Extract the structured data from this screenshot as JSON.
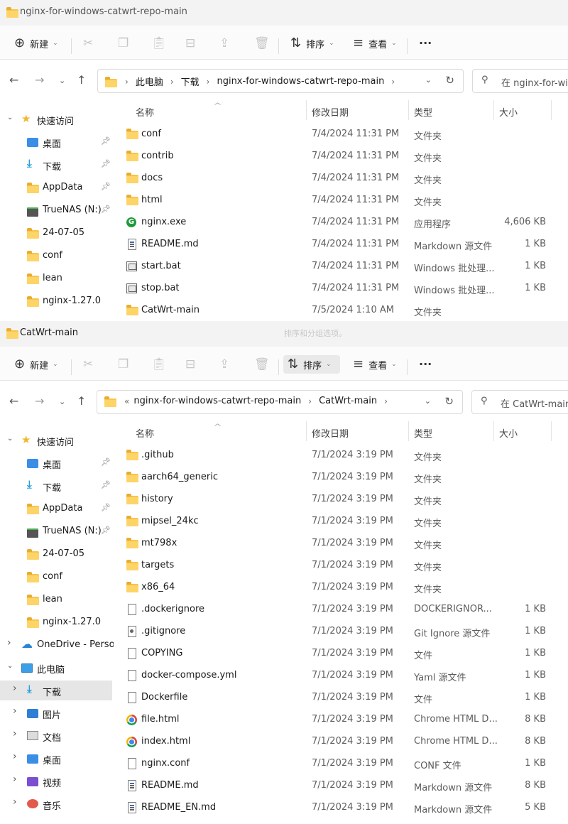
{
  "window1": {
    "title": "nginx-for-windows-catwrt-repo-main",
    "toolbar": {
      "new": "新建",
      "sort": "排序",
      "view": "查看",
      "more": "···"
    },
    "path": [
      "此电脑",
      "下载",
      "nginx-for-windows-catwrt-repo-main"
    ],
    "search_placeholder": "在 nginx-for-windo",
    "columns": {
      "name": "名称",
      "modified": "修改日期",
      "type": "类型",
      "size": "大小"
    },
    "sidebar": [
      {
        "label": "快速访问",
        "icon": "star-icon",
        "pinned": false
      },
      {
        "label": "桌面",
        "icon": "desktop-icon",
        "pinned": true
      },
      {
        "label": "下载",
        "icon": "download-icon",
        "pinned": true
      },
      {
        "label": "AppData",
        "icon": "folder-icon",
        "pinned": true
      },
      {
        "label": "TrueNAS (N:)",
        "icon": "network-drive-icon",
        "pinned": true
      },
      {
        "label": "24-07-05",
        "icon": "folder-icon",
        "pinned": false
      },
      {
        "label": "conf",
        "icon": "folder-icon",
        "pinned": false
      },
      {
        "label": "lean",
        "icon": "folder-icon",
        "pinned": false
      },
      {
        "label": "nginx-1.27.0",
        "icon": "folder-icon",
        "pinned": false
      }
    ],
    "files": [
      {
        "name": "conf",
        "date": "7/4/2024 11:31 PM",
        "type": "文件夹",
        "size": "",
        "icon": "folder"
      },
      {
        "name": "contrib",
        "date": "7/4/2024 11:31 PM",
        "type": "文件夹",
        "size": "",
        "icon": "folder"
      },
      {
        "name": "docs",
        "date": "7/4/2024 11:31 PM",
        "type": "文件夹",
        "size": "",
        "icon": "folder"
      },
      {
        "name": "html",
        "date": "7/4/2024 11:31 PM",
        "type": "文件夹",
        "size": "",
        "icon": "folder"
      },
      {
        "name": "nginx.exe",
        "date": "7/4/2024 11:31 PM",
        "type": "应用程序",
        "size": "4,606 KB",
        "icon": "exe"
      },
      {
        "name": "README.md",
        "date": "7/4/2024 11:31 PM",
        "type": "Markdown 源文件",
        "size": "1 KB",
        "icon": "md"
      },
      {
        "name": "start.bat",
        "date": "7/4/2024 11:31 PM",
        "type": "Windows 批处理...",
        "size": "1 KB",
        "icon": "bat"
      },
      {
        "name": "stop.bat",
        "date": "7/4/2024 11:31 PM",
        "type": "Windows 批处理...",
        "size": "1 KB",
        "icon": "bat"
      },
      {
        "name": "CatWrt-main",
        "date": "7/5/2024 1:10 AM",
        "type": "文件夹",
        "size": "",
        "icon": "folder"
      }
    ]
  },
  "window2": {
    "title": "CatWrt-main",
    "tooltip": "排序和分组选项。",
    "toolbar": {
      "new": "新建",
      "sort": "排序",
      "view": "查看",
      "more": "···"
    },
    "path_overflow": "«",
    "path": [
      "nginx-for-windows-catwrt-repo-main",
      "CatWrt-main"
    ],
    "search_placeholder": "在 CatWrt-main 中",
    "columns": {
      "name": "名称",
      "modified": "修改日期",
      "type": "类型",
      "size": "大小"
    },
    "sidebar": [
      {
        "label": "快速访问",
        "icon": "star-icon",
        "pinned": false,
        "expand": "v"
      },
      {
        "label": "桌面",
        "icon": "desktop-icon",
        "pinned": true
      },
      {
        "label": "下载",
        "icon": "download-icon",
        "pinned": true
      },
      {
        "label": "AppData",
        "icon": "folder-icon",
        "pinned": true
      },
      {
        "label": "TrueNAS (N:)",
        "icon": "network-drive-icon",
        "pinned": true
      },
      {
        "label": "24-07-05",
        "icon": "folder-icon",
        "pinned": false
      },
      {
        "label": "conf",
        "icon": "folder-icon",
        "pinned": false
      },
      {
        "label": "lean",
        "icon": "folder-icon",
        "pinned": false
      },
      {
        "label": "nginx-1.27.0",
        "icon": "folder-icon",
        "pinned": false
      },
      {
        "label": "OneDrive - Persor",
        "icon": "cloud-icon",
        "pinned": false,
        "expand": ">"
      },
      {
        "label": "此电脑",
        "icon": "pc-icon",
        "pinned": false,
        "expand": "v"
      },
      {
        "label": "下载",
        "icon": "download-icon",
        "pinned": false,
        "expand": ">",
        "selected": true
      },
      {
        "label": "图片",
        "icon": "pictures-icon",
        "pinned": false,
        "expand": ">"
      },
      {
        "label": "文档",
        "icon": "documents-icon",
        "pinned": false,
        "expand": ">"
      },
      {
        "label": "桌面",
        "icon": "desktop-icon",
        "pinned": false,
        "expand": ">"
      },
      {
        "label": "视频",
        "icon": "videos-icon",
        "pinned": false,
        "expand": ">"
      },
      {
        "label": "音乐",
        "icon": "music-icon",
        "pinned": false,
        "expand": ">"
      }
    ],
    "files": [
      {
        "name": ".github",
        "date": "7/1/2024 3:19 PM",
        "type": "文件夹",
        "size": "",
        "icon": "folder"
      },
      {
        "name": "aarch64_generic",
        "date": "7/1/2024 3:19 PM",
        "type": "文件夹",
        "size": "",
        "icon": "folder"
      },
      {
        "name": "history",
        "date": "7/1/2024 3:19 PM",
        "type": "文件夹",
        "size": "",
        "icon": "folder"
      },
      {
        "name": "mipsel_24kc",
        "date": "7/1/2024 3:19 PM",
        "type": "文件夹",
        "size": "",
        "icon": "folder"
      },
      {
        "name": "mt798x",
        "date": "7/1/2024 3:19 PM",
        "type": "文件夹",
        "size": "",
        "icon": "folder"
      },
      {
        "name": "targets",
        "date": "7/1/2024 3:19 PM",
        "type": "文件夹",
        "size": "",
        "icon": "folder"
      },
      {
        "name": "x86_64",
        "date": "7/1/2024 3:19 PM",
        "type": "文件夹",
        "size": "",
        "icon": "folder"
      },
      {
        "name": ".dockerignore",
        "date": "7/1/2024 3:19 PM",
        "type": "DOCKERIGNOR...",
        "size": "1 KB",
        "icon": "blank"
      },
      {
        "name": ".gitignore",
        "date": "7/1/2024 3:19 PM",
        "type": "Git Ignore 源文件",
        "size": "1 KB",
        "icon": "git"
      },
      {
        "name": "COPYING",
        "date": "7/1/2024 3:19 PM",
        "type": "文件",
        "size": "1 KB",
        "icon": "blank"
      },
      {
        "name": "docker-compose.yml",
        "date": "7/1/2024 3:19 PM",
        "type": "Yaml 源文件",
        "size": "1 KB",
        "icon": "blank"
      },
      {
        "name": "Dockerfile",
        "date": "7/1/2024 3:19 PM",
        "type": "文件",
        "size": "1 KB",
        "icon": "blank"
      },
      {
        "name": "file.html",
        "date": "7/1/2024 3:19 PM",
        "type": "Chrome HTML D...",
        "size": "8 KB",
        "icon": "chrome"
      },
      {
        "name": "index.html",
        "date": "7/1/2024 3:19 PM",
        "type": "Chrome HTML D...",
        "size": "8 KB",
        "icon": "chrome"
      },
      {
        "name": "nginx.conf",
        "date": "7/1/2024 3:19 PM",
        "type": "CONF 文件",
        "size": "1 KB",
        "icon": "blank"
      },
      {
        "name": "README.md",
        "date": "7/1/2024 3:19 PM",
        "type": "Markdown 源文件",
        "size": "8 KB",
        "icon": "md"
      },
      {
        "name": "README_EN.md",
        "date": "7/1/2024 3:19 PM",
        "type": "Markdown 源文件",
        "size": "5 KB",
        "icon": "md"
      }
    ]
  }
}
